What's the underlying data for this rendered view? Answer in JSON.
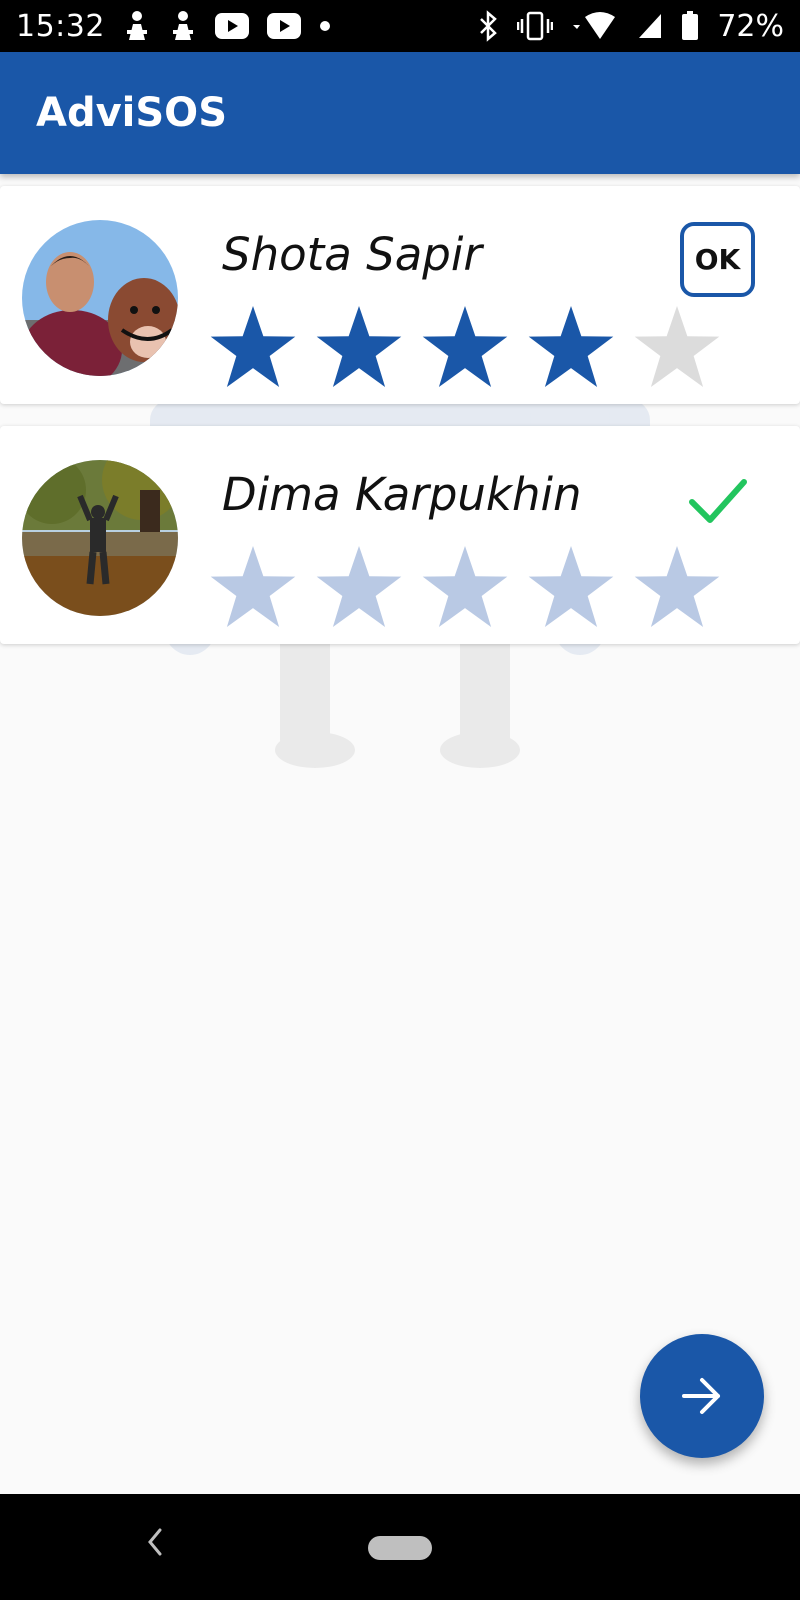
{
  "status_bar": {
    "time": "15:32",
    "battery": "72%",
    "left_icons": [
      "notification-icon",
      "notification-icon",
      "youtube-icon",
      "youtube-icon",
      "dot-icon"
    ],
    "right_icons": [
      "bluetooth-icon",
      "vibrate-icon",
      "wifi-icon",
      "cell-signal-icon",
      "battery-icon"
    ]
  },
  "app_bar": {
    "title": "AdviSOS"
  },
  "colors": {
    "primary": "#1a57a8",
    "star_filled": "#1a57a8",
    "star_empty": "#dcdcdc",
    "star_faded": "#b9c9e4",
    "check": "#22c55e"
  },
  "people": [
    {
      "name": "Shota Sapir",
      "rating": 4,
      "max_rating": 5,
      "action": "OK",
      "status": "pending"
    },
    {
      "name": "Dima Karpukhin",
      "rating": 5,
      "max_rating": 5,
      "status": "completed"
    }
  ],
  "fab": {
    "icon": "arrow-right-icon"
  },
  "nav_bar": {
    "icons": [
      "back-icon",
      "home-pill"
    ]
  }
}
